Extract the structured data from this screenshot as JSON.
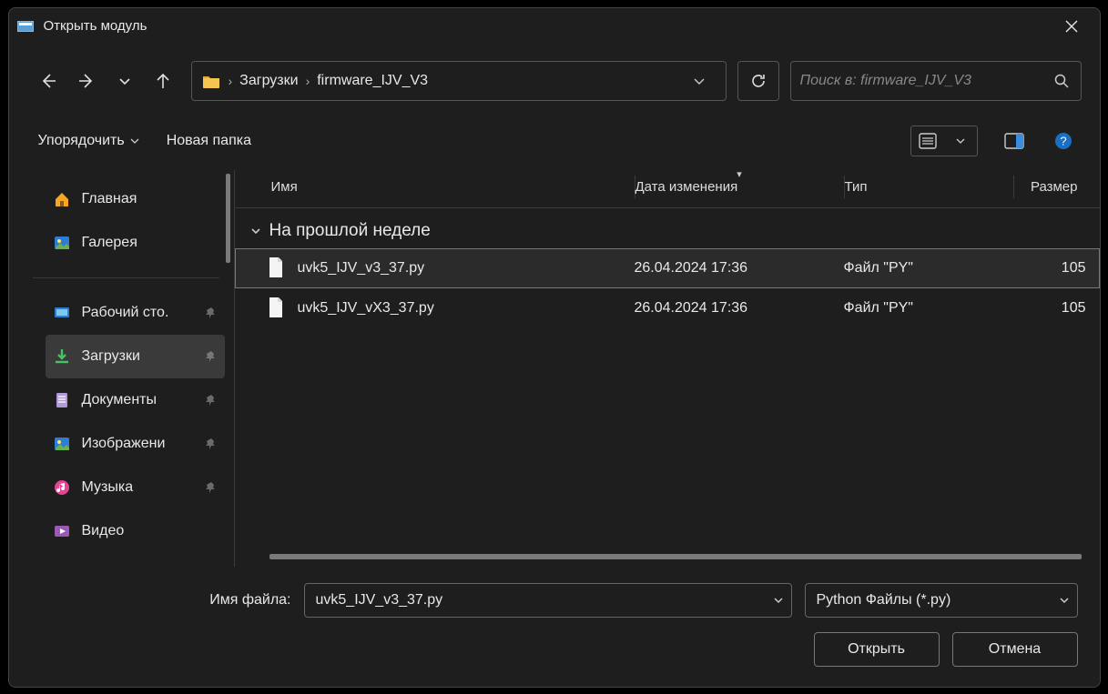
{
  "window": {
    "title": "Открыть модуль"
  },
  "breadcrumb": {
    "part1": "Загрузки",
    "part2": "firmware_IJV_V3"
  },
  "search": {
    "placeholder": "Поиск в: firmware_IJV_V3"
  },
  "toolbar": {
    "organize": "Упорядочить",
    "new_folder": "Новая папка"
  },
  "sidebar": {
    "home": "Главная",
    "gallery": "Галерея",
    "desktop": "Рабочий сто.",
    "downloads": "Загрузки",
    "documents": "Документы",
    "pictures": "Изображени",
    "music": "Музыка",
    "videos": "Видео"
  },
  "columns": {
    "name": "Имя",
    "date": "Дата изменения",
    "type": "Тип",
    "size": "Размер"
  },
  "group": {
    "label": "На прошлой неделе"
  },
  "files": [
    {
      "name": "uvk5_IJV_v3_37.py",
      "date": "26.04.2024 17:36",
      "type": "Файл \"PY\"",
      "size": "105"
    },
    {
      "name": "uvk5_IJV_vX3_37.py",
      "date": "26.04.2024 17:36",
      "type": "Файл \"PY\"",
      "size": "105"
    }
  ],
  "footer": {
    "filename_label": "Имя файла:",
    "filename_value": "uvk5_IJV_v3_37.py",
    "filter": "Python Файлы (*.py)",
    "open": "Открыть",
    "cancel": "Отмена"
  }
}
